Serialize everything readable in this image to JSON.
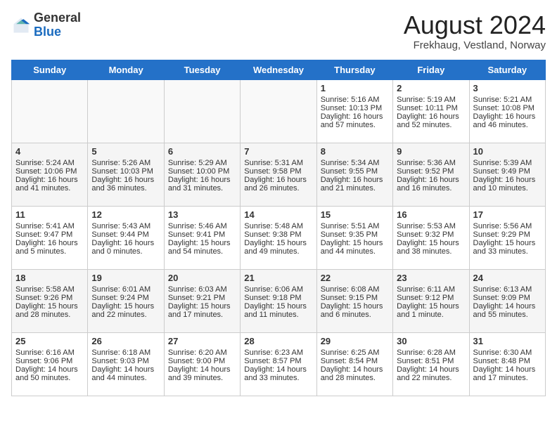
{
  "header": {
    "logo_general": "General",
    "logo_blue": "Blue",
    "title": "August 2024",
    "subtitle": "Frekhaug, Vestland, Norway"
  },
  "days_of_week": [
    "Sunday",
    "Monday",
    "Tuesday",
    "Wednesday",
    "Thursday",
    "Friday",
    "Saturday"
  ],
  "weeks": [
    [
      {
        "day": "",
        "content": ""
      },
      {
        "day": "",
        "content": ""
      },
      {
        "day": "",
        "content": ""
      },
      {
        "day": "",
        "content": ""
      },
      {
        "day": "1",
        "content": "Sunrise: 5:16 AM\nSunset: 10:13 PM\nDaylight: 16 hours\nand 57 minutes."
      },
      {
        "day": "2",
        "content": "Sunrise: 5:19 AM\nSunset: 10:11 PM\nDaylight: 16 hours\nand 52 minutes."
      },
      {
        "day": "3",
        "content": "Sunrise: 5:21 AM\nSunset: 10:08 PM\nDaylight: 16 hours\nand 46 minutes."
      }
    ],
    [
      {
        "day": "4",
        "content": "Sunrise: 5:24 AM\nSunset: 10:06 PM\nDaylight: 16 hours\nand 41 minutes."
      },
      {
        "day": "5",
        "content": "Sunrise: 5:26 AM\nSunset: 10:03 PM\nDaylight: 16 hours\nand 36 minutes."
      },
      {
        "day": "6",
        "content": "Sunrise: 5:29 AM\nSunset: 10:00 PM\nDaylight: 16 hours\nand 31 minutes."
      },
      {
        "day": "7",
        "content": "Sunrise: 5:31 AM\nSunset: 9:58 PM\nDaylight: 16 hours\nand 26 minutes."
      },
      {
        "day": "8",
        "content": "Sunrise: 5:34 AM\nSunset: 9:55 PM\nDaylight: 16 hours\nand 21 minutes."
      },
      {
        "day": "9",
        "content": "Sunrise: 5:36 AM\nSunset: 9:52 PM\nDaylight: 16 hours\nand 16 minutes."
      },
      {
        "day": "10",
        "content": "Sunrise: 5:39 AM\nSunset: 9:49 PM\nDaylight: 16 hours\nand 10 minutes."
      }
    ],
    [
      {
        "day": "11",
        "content": "Sunrise: 5:41 AM\nSunset: 9:47 PM\nDaylight: 16 hours\nand 5 minutes."
      },
      {
        "day": "12",
        "content": "Sunrise: 5:43 AM\nSunset: 9:44 PM\nDaylight: 16 hours\nand 0 minutes."
      },
      {
        "day": "13",
        "content": "Sunrise: 5:46 AM\nSunset: 9:41 PM\nDaylight: 15 hours\nand 54 minutes."
      },
      {
        "day": "14",
        "content": "Sunrise: 5:48 AM\nSunset: 9:38 PM\nDaylight: 15 hours\nand 49 minutes."
      },
      {
        "day": "15",
        "content": "Sunrise: 5:51 AM\nSunset: 9:35 PM\nDaylight: 15 hours\nand 44 minutes."
      },
      {
        "day": "16",
        "content": "Sunrise: 5:53 AM\nSunset: 9:32 PM\nDaylight: 15 hours\nand 38 minutes."
      },
      {
        "day": "17",
        "content": "Sunrise: 5:56 AM\nSunset: 9:29 PM\nDaylight: 15 hours\nand 33 minutes."
      }
    ],
    [
      {
        "day": "18",
        "content": "Sunrise: 5:58 AM\nSunset: 9:26 PM\nDaylight: 15 hours\nand 28 minutes."
      },
      {
        "day": "19",
        "content": "Sunrise: 6:01 AM\nSunset: 9:24 PM\nDaylight: 15 hours\nand 22 minutes."
      },
      {
        "day": "20",
        "content": "Sunrise: 6:03 AM\nSunset: 9:21 PM\nDaylight: 15 hours\nand 17 minutes."
      },
      {
        "day": "21",
        "content": "Sunrise: 6:06 AM\nSunset: 9:18 PM\nDaylight: 15 hours\nand 11 minutes."
      },
      {
        "day": "22",
        "content": "Sunrise: 6:08 AM\nSunset: 9:15 PM\nDaylight: 15 hours\nand 6 minutes."
      },
      {
        "day": "23",
        "content": "Sunrise: 6:11 AM\nSunset: 9:12 PM\nDaylight: 15 hours\nand 1 minute."
      },
      {
        "day": "24",
        "content": "Sunrise: 6:13 AM\nSunset: 9:09 PM\nDaylight: 14 hours\nand 55 minutes."
      }
    ],
    [
      {
        "day": "25",
        "content": "Sunrise: 6:16 AM\nSunset: 9:06 PM\nDaylight: 14 hours\nand 50 minutes."
      },
      {
        "day": "26",
        "content": "Sunrise: 6:18 AM\nSunset: 9:03 PM\nDaylight: 14 hours\nand 44 minutes."
      },
      {
        "day": "27",
        "content": "Sunrise: 6:20 AM\nSunset: 9:00 PM\nDaylight: 14 hours\nand 39 minutes."
      },
      {
        "day": "28",
        "content": "Sunrise: 6:23 AM\nSunset: 8:57 PM\nDaylight: 14 hours\nand 33 minutes."
      },
      {
        "day": "29",
        "content": "Sunrise: 6:25 AM\nSunset: 8:54 PM\nDaylight: 14 hours\nand 28 minutes."
      },
      {
        "day": "30",
        "content": "Sunrise: 6:28 AM\nSunset: 8:51 PM\nDaylight: 14 hours\nand 22 minutes."
      },
      {
        "day": "31",
        "content": "Sunrise: 6:30 AM\nSunset: 8:48 PM\nDaylight: 14 hours\nand 17 minutes."
      }
    ]
  ]
}
